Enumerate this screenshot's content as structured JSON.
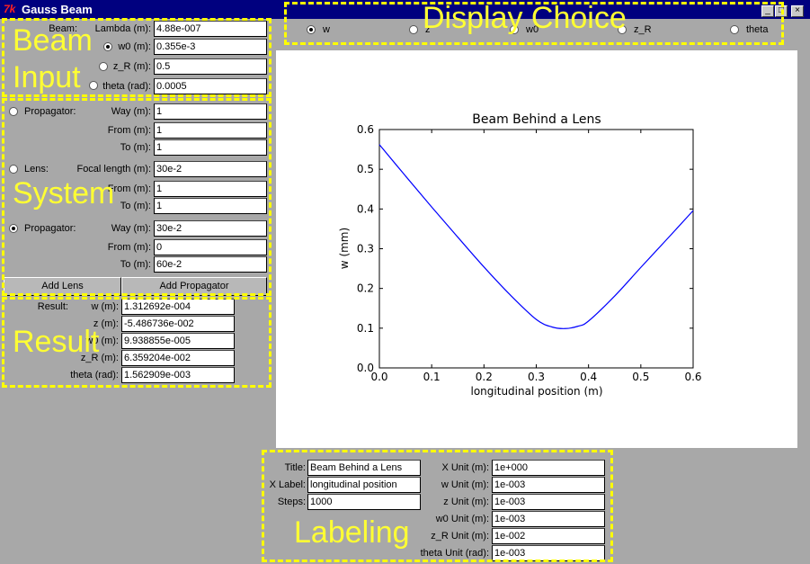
{
  "window": {
    "logo": "7k",
    "title": "Gauss Beam",
    "controls": [
      "_",
      "□",
      "×"
    ]
  },
  "display_choice": {
    "options": [
      "w",
      "z",
      "w0",
      "z_R",
      "theta"
    ],
    "selected": "w"
  },
  "beam_input": {
    "heading": "Beam:",
    "rows": [
      {
        "label": "Lambda (m):",
        "value": "4.88e-007",
        "radio": null
      },
      {
        "label": "w0 (m):",
        "value": "0.355e-3",
        "radio": true
      },
      {
        "label": "z_R (m):",
        "value": "0.5",
        "radio": false
      },
      {
        "label": "theta (rad):",
        "value": "0.0005",
        "radio": false
      }
    ]
  },
  "system": {
    "elements": [
      {
        "type": "Propagator:",
        "selected": false,
        "fields": [
          {
            "label": "Way (m):",
            "value": "1"
          },
          {
            "label": "From (m):",
            "value": "1"
          },
          {
            "label": "To (m):",
            "value": "1"
          }
        ]
      },
      {
        "type": "Lens:",
        "selected": false,
        "fields": [
          {
            "label": "Focal length (m):",
            "value": "30e-2"
          },
          {
            "label": "From (m):",
            "value": "1"
          },
          {
            "label": "To (m):",
            "value": "1"
          }
        ]
      },
      {
        "type": "Propagator:",
        "selected": true,
        "fields": [
          {
            "label": "Way (m):",
            "value": "30e-2"
          },
          {
            "label": "From (m):",
            "value": "0"
          },
          {
            "label": "To (m):",
            "value": "60e-2"
          }
        ]
      }
    ],
    "add_lens_label": "Add Lens",
    "add_propagator_label": "Add Propagator"
  },
  "result": {
    "heading": "Result:",
    "rows": [
      {
        "label": "w (m):",
        "value": "1.312692e-004"
      },
      {
        "label": "z (m):",
        "value": "-5.486736e-002"
      },
      {
        "label": "w0 (m):",
        "value": "9.938855e-005"
      },
      {
        "label": "z_R (m):",
        "value": "6.359204e-002"
      },
      {
        "label": "theta (rad):",
        "value": "1.562909e-003"
      }
    ]
  },
  "labeling": {
    "left": [
      {
        "label": "Title:",
        "value": "Beam Behind a Lens"
      },
      {
        "label": "X Label:",
        "value": "longitudinal position"
      },
      {
        "label": "Steps:",
        "value": "1000"
      }
    ],
    "right": [
      {
        "label": "X Unit (m):",
        "value": "1e+000"
      },
      {
        "label": "w Unit (m):",
        "value": "1e-003"
      },
      {
        "label": "z Unit (m):",
        "value": "1e-003"
      },
      {
        "label": "w0 Unit (m):",
        "value": "1e-003"
      },
      {
        "label": "z_R Unit (m):",
        "value": "1e-002"
      },
      {
        "label": "theta Unit (rad):",
        "value": "1e-003"
      }
    ]
  },
  "annotations": {
    "beam_input": [
      "Beam",
      "Input"
    ],
    "system": "System",
    "result": "Result",
    "display_choice": "Display Choice",
    "labeling": "Labeling",
    "color": "#ffff00"
  },
  "chart_data": {
    "type": "line",
    "title": "Beam Behind a Lens",
    "xlabel": "longitudinal position (m)",
    "ylabel": "w (mm)",
    "xlim": [
      0,
      0.6
    ],
    "ylim": [
      0,
      0.6
    ],
    "xticks": [
      "0.0",
      "0.1",
      "0.2",
      "0.3",
      "0.4",
      "0.5",
      "0.6"
    ],
    "yticks": [
      "0.0",
      "0.1",
      "0.2",
      "0.3",
      "0.4",
      "0.5",
      "0.6"
    ],
    "grid": false,
    "line_color": "#0000ff",
    "series": [
      {
        "x": [
          0,
          0.05,
          0.1,
          0.15,
          0.2,
          0.25,
          0.3,
          0.33,
          0.355,
          0.38,
          0.4,
          0.45,
          0.5,
          0.55,
          0.6
        ],
        "values": [
          0.562,
          0.483,
          0.405,
          0.329,
          0.254,
          0.184,
          0.122,
          0.103,
          0.099,
          0.105,
          0.118,
          0.181,
          0.253,
          0.324,
          0.396
        ]
      }
    ]
  }
}
